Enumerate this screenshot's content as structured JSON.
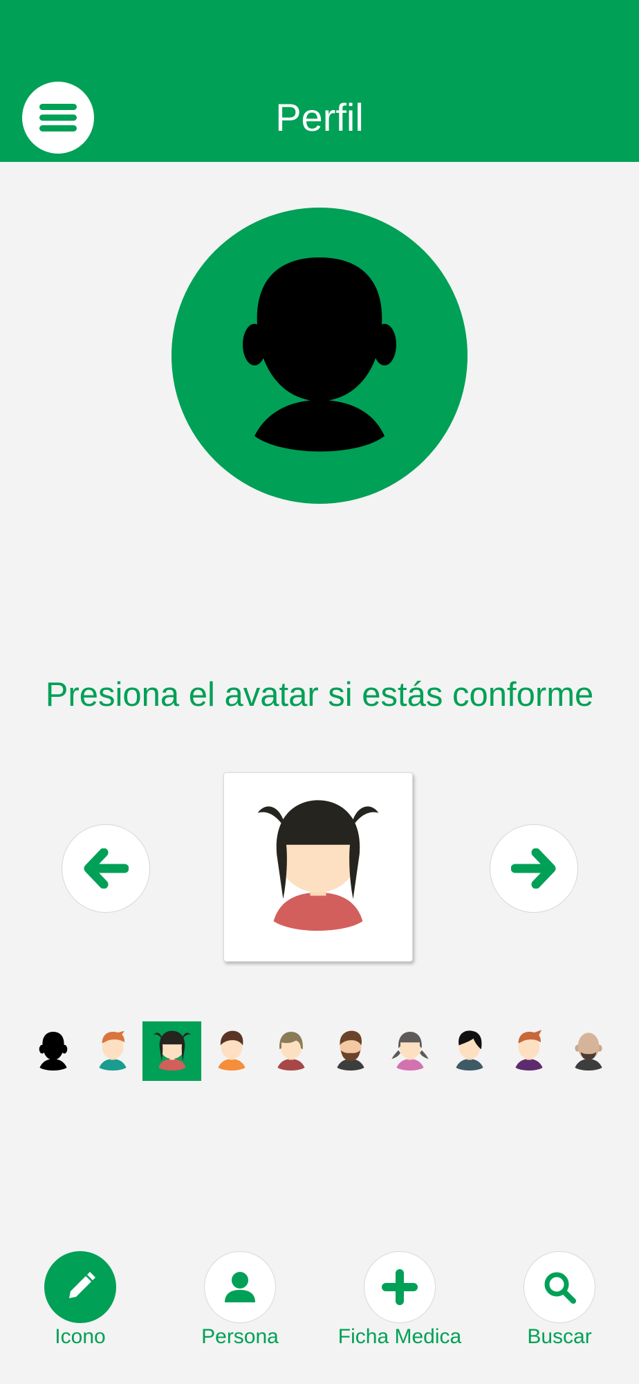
{
  "colors": {
    "accent": "#00a056",
    "background": "#f3f3f3",
    "surface": "#ffffff"
  },
  "header": {
    "title": "Perfil",
    "menu_icon": "menu-icon"
  },
  "main": {
    "avatar_icon": "silhouette-avatar",
    "instruction": "Presiona el avatar si estás conforme",
    "prev_icon": "arrow-left-icon",
    "next_icon": "arrow-right-icon",
    "preview_icon": "avatar-girl-black-hair"
  },
  "thumbnails": [
    {
      "icon": "avatar-silhouette",
      "selected": false
    },
    {
      "icon": "avatar-boy-ginger",
      "selected": false
    },
    {
      "icon": "avatar-girl-black-hair",
      "selected": true
    },
    {
      "icon": "avatar-man-brown-hair",
      "selected": false
    },
    {
      "icon": "avatar-woman-light-brown",
      "selected": false
    },
    {
      "icon": "avatar-man-beard",
      "selected": false
    },
    {
      "icon": "avatar-girl-pigtails",
      "selected": false
    },
    {
      "icon": "avatar-boy-black-hair",
      "selected": false
    },
    {
      "icon": "avatar-woman-ginger",
      "selected": false
    },
    {
      "icon": "avatar-bald-man-beard",
      "selected": false
    }
  ],
  "bottom_nav": [
    {
      "label": "Icono",
      "icon": "pencil-icon",
      "active": true
    },
    {
      "label": "Persona",
      "icon": "person-icon",
      "active": false
    },
    {
      "label": "Ficha Medica",
      "icon": "plus-icon",
      "active": false
    },
    {
      "label": "Buscar",
      "icon": "search-icon",
      "active": false
    }
  ]
}
